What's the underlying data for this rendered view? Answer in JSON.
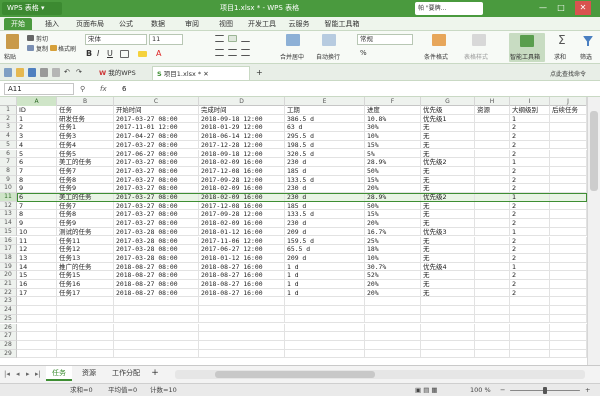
{
  "titlebar": {
    "app_name": "WPS 表格",
    "title": "项目1.xlsx * - WPS 表格",
    "user": "帕 \"要牌...",
    "controls": [
      "—",
      "□",
      "✕"
    ]
  },
  "menu": {
    "items": [
      "开始",
      "插入",
      "页面布局",
      "公式",
      "数据",
      "审阅",
      "视图",
      "开发工具",
      "云服务",
      "智能工具箱"
    ]
  },
  "ribbon": {
    "paste": "粘贴",
    "cut": "剪切",
    "copy": "复制",
    "format_painter": "格式刷",
    "font_name": "宋体",
    "font_size": "11",
    "merge": "合并居中",
    "autowrap": "自动换行",
    "number_format": "常规",
    "percent": "%",
    "conditional_format": "条件格式",
    "table_style": "表格样式",
    "smart_toolbox": "智能工具箱",
    "sum": "求和",
    "filter": "筛选"
  },
  "doc_tabs": {
    "tab1": "我的WPS",
    "tab2": "项目1.xlsx *",
    "search_hint": "点此查找命令"
  },
  "formula": {
    "cell_ref": "A11",
    "fx": "fx",
    "value": "6"
  },
  "grid": {
    "col_letters": [
      "A",
      "B",
      "C",
      "D",
      "E",
      "F",
      "G",
      "H",
      "I",
      "J"
    ],
    "rows": [
      {
        "num": "1",
        "cells": [
          "ID",
          "任务",
          "开始时间",
          "完成时间",
          "工期",
          "进度",
          "优先级",
          "资源",
          "大纲级别",
          "后续任务"
        ]
      },
      {
        "num": "2",
        "cells": [
          "1",
          "研发任务",
          "2017-03-27 08:00",
          "2018-09-18 12:00",
          "386.5 d",
          "10.8%",
          "优先级1",
          "",
          "1",
          ""
        ]
      },
      {
        "num": "3",
        "cells": [
          "2",
          "任务1",
          "2017-11-01 12:00",
          "2018-01-29 12:00",
          "63 d",
          "30%",
          "无",
          "",
          "2",
          ""
        ]
      },
      {
        "num": "4",
        "cells": [
          "3",
          "任务3",
          "2017-04-27 08:00",
          "2018-06-14 12:00",
          "295.5 d",
          "10%",
          "无",
          "",
          "2",
          ""
        ]
      },
      {
        "num": "5",
        "cells": [
          "4",
          "任务4",
          "2017-03-27 08:00",
          "2017-12-28 12:00",
          "198.5 d",
          "15%",
          "无",
          "",
          "2",
          ""
        ]
      },
      {
        "num": "6",
        "cells": [
          "5",
          "任务5",
          "2017-06-27 08:00",
          "2018-09-18 12:00",
          "320.5 d",
          "5%",
          "无",
          "",
          "2",
          ""
        ]
      },
      {
        "num": "7",
        "cells": [
          "6",
          "美工的任务",
          "2017-03-27 08:00",
          "2018-02-09 16:00",
          "230 d",
          "28.9%",
          "优先级2",
          "",
          "1",
          ""
        ]
      },
      {
        "num": "8",
        "cells": [
          "7",
          "任务7",
          "2017-03-27 08:00",
          "2017-12-08 16:00",
          "185 d",
          "50%",
          "无",
          "",
          "2",
          ""
        ]
      },
      {
        "num": "9",
        "cells": [
          "8",
          "任务8",
          "2017-03-27 08:00",
          "2017-09-28 12:00",
          "133.5 d",
          "15%",
          "无",
          "",
          "2",
          ""
        ]
      },
      {
        "num": "10",
        "cells": [
          "9",
          "任务9",
          "2017-03-27 08:00",
          "2018-02-09 16:00",
          "230 d",
          "20%",
          "无",
          "",
          "2",
          ""
        ]
      },
      {
        "num": "11",
        "cells": [
          "6",
          "美工的任务",
          "2017-03-27 08:00",
          "2018-02-09 16:00",
          "230 d",
          "28.9%",
          "优先级2",
          "",
          "1",
          ""
        ]
      },
      {
        "num": "12",
        "cells": [
          "7",
          "任务7",
          "2017-03-27 08:00",
          "2017-12-08 16:00",
          "185 d",
          "50%",
          "无",
          "",
          "2",
          ""
        ]
      },
      {
        "num": "13",
        "cells": [
          "8",
          "任务8",
          "2017-03-27 08:00",
          "2017-09-28 12:00",
          "133.5 d",
          "15%",
          "无",
          "",
          "2",
          ""
        ]
      },
      {
        "num": "14",
        "cells": [
          "9",
          "任务9",
          "2017-03-27 08:00",
          "2018-02-09 16:00",
          "230 d",
          "20%",
          "无",
          "",
          "2",
          ""
        ]
      },
      {
        "num": "15",
        "cells": [
          "10",
          "测试的任务",
          "2017-03-28 08:00",
          "2018-01-12 16:00",
          "209 d",
          "16.7%",
          "优先级3",
          "",
          "1",
          ""
        ]
      },
      {
        "num": "16",
        "cells": [
          "11",
          "任务11",
          "2017-03-28 08:00",
          "2017-11-06 12:00",
          "159.5 d",
          "25%",
          "无",
          "",
          "2",
          ""
        ]
      },
      {
        "num": "17",
        "cells": [
          "12",
          "任务12",
          "2017-03-28 08:00",
          "2017-06-27 12:00",
          "65.5 d",
          "18%",
          "无",
          "",
          "2",
          ""
        ]
      },
      {
        "num": "18",
        "cells": [
          "13",
          "任务13",
          "2017-03-28 08:00",
          "2018-01-12 16:00",
          "209 d",
          "10%",
          "无",
          "",
          "2",
          ""
        ]
      },
      {
        "num": "19",
        "cells": [
          "14",
          "推广的任务",
          "2018-08-27 08:00",
          "2018-08-27 16:00",
          "1 d",
          "30.7%",
          "优先级4",
          "",
          "1",
          ""
        ]
      },
      {
        "num": "20",
        "cells": [
          "15",
          "任务15",
          "2018-08-27 08:00",
          "2018-08-27 16:00",
          "1 d",
          "52%",
          "无",
          "",
          "2",
          ""
        ]
      },
      {
        "num": "21",
        "cells": [
          "16",
          "任务16",
          "2018-08-27 08:00",
          "2018-08-27 16:00",
          "1 d",
          "20%",
          "无",
          "",
          "2",
          ""
        ]
      },
      {
        "num": "22",
        "cells": [
          "17",
          "任务17",
          "2018-08-27 08:00",
          "2018-08-27 16:00",
          "1 d",
          "20%",
          "无",
          "",
          "2",
          ""
        ]
      },
      {
        "num": "23",
        "cells": [
          "",
          "",
          "",
          "",
          "",
          "",
          "",
          "",
          "",
          ""
        ]
      },
      {
        "num": "24",
        "cells": [
          "",
          "",
          "",
          "",
          "",
          "",
          "",
          "",
          "",
          ""
        ]
      },
      {
        "num": "25",
        "cells": [
          "",
          "",
          "",
          "",
          "",
          "",
          "",
          "",
          "",
          ""
        ]
      },
      {
        "num": "26",
        "cells": [
          "",
          "",
          "",
          "",
          "",
          "",
          "",
          "",
          "",
          ""
        ]
      },
      {
        "num": "27",
        "cells": [
          "",
          "",
          "",
          "",
          "",
          "",
          "",
          "",
          "",
          ""
        ]
      },
      {
        "num": "28",
        "cells": [
          "",
          "",
          "",
          "",
          "",
          "",
          "",
          "",
          "",
          ""
        ]
      },
      {
        "num": "29",
        "cells": [
          "",
          "",
          "",
          "",
          "",
          "",
          "",
          "",
          "",
          ""
        ]
      }
    ],
    "selected_row_index": 10
  },
  "sheets": {
    "tabs": [
      "任务",
      "资源",
      "工作分配"
    ],
    "add": "+"
  },
  "status": {
    "sum": "求和=0",
    "avg": "平均值=0",
    "count": "计数=10",
    "zoom": "100 %"
  },
  "colors": {
    "accent": "#4a9a3e",
    "selection": "#3e8e33"
  }
}
